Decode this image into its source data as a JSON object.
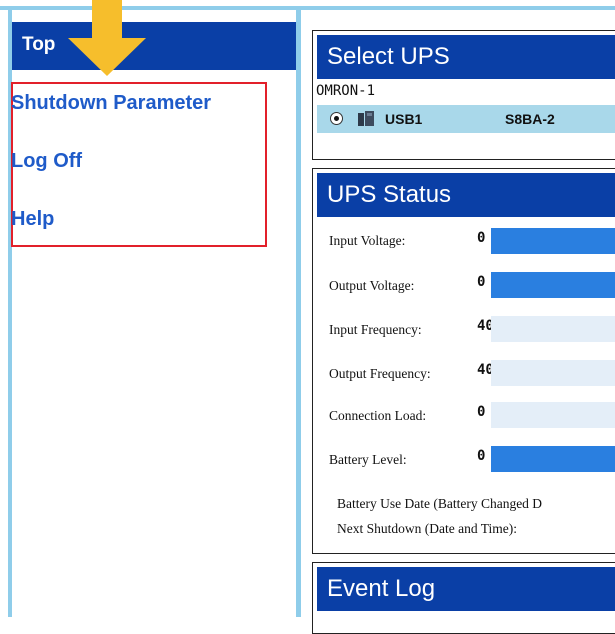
{
  "sidebar": {
    "top_label": "Top",
    "menu": [
      {
        "label": "Shutdown Parameter"
      },
      {
        "label": "Log Off"
      },
      {
        "label": "Help"
      }
    ]
  },
  "select_ups": {
    "title": "Select UPS",
    "group_name": "OMRON-1",
    "device": {
      "port": "USB1",
      "model": "S8BA-2"
    }
  },
  "ups_status": {
    "title": "UPS Status",
    "rows": [
      {
        "label": "Input Voltage:",
        "value": "0",
        "level": 1.0
      },
      {
        "label": "Output Voltage:",
        "value": "0",
        "level": 1.0
      },
      {
        "label": "Input Frequency:",
        "value": "40",
        "level": 0
      },
      {
        "label": "Output Frequency:",
        "value": "40",
        "level": 0
      },
      {
        "label": "Connection Load:",
        "value": "0",
        "level": 0
      },
      {
        "label": "Battery Level:",
        "value": "0",
        "level": 1.0
      }
    ],
    "battery_use_date_label": "Battery Use Date (Battery Changed D",
    "next_shutdown_label": "Next Shutdown (Date and Time):"
  },
  "event_log": {
    "title": "Event Log"
  },
  "colors": {
    "header_blue": "#0a3fa6",
    "link_blue": "#1f5bc9",
    "highlight_red": "#e2202a",
    "frame_light_blue": "#8fcdea",
    "selected_row": "#a9d8ea",
    "bar_fill": "#2a7fe0",
    "bar_track": "#e4eef8",
    "arrow_yellow": "#f6be2c"
  }
}
